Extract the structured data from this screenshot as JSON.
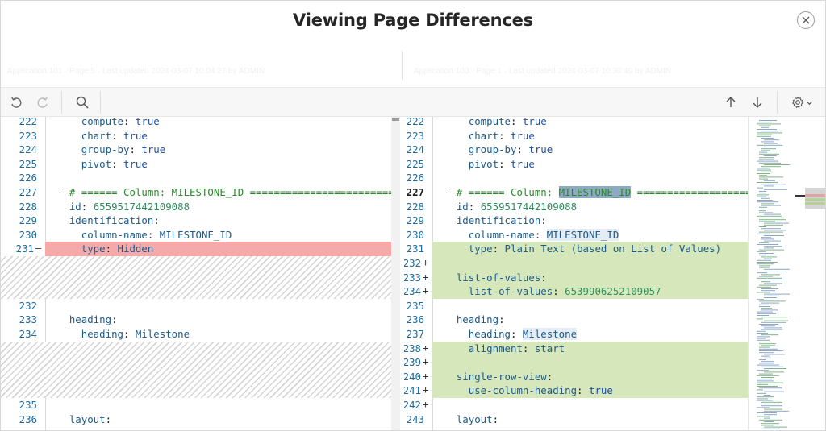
{
  "dialog": {
    "title": "Viewing Page Differences"
  },
  "info": {
    "left": "Application 101 · Page 5 · Last updated 2024-03-07 10:04:27 by ADMIN",
    "right": "Application 100 · Page 1 · Last updated 2024-03-07 10:30:49 by ADMIN"
  },
  "toolbar": {
    "undo_icon": "undo-icon",
    "redo_icon": "redo-icon",
    "search_icon": "search-icon",
    "prev_icon": "arrow-up-icon",
    "next_icon": "arrow-down-icon",
    "settings_icon": "gear-icon"
  },
  "colors": {
    "deleted": "#f5a9a9",
    "added": "#d6e8bb",
    "line_number": "#1e6a9e"
  },
  "left_lines": [
    {
      "num": "222",
      "text": "      compute: true"
    },
    {
      "num": "223",
      "text": "      chart: true"
    },
    {
      "num": "224",
      "text": "      group-by: true"
    },
    {
      "num": "225",
      "text": "      pivot: true"
    },
    {
      "num": "226",
      "text": ""
    },
    {
      "num": "227",
      "text": "  - # ====== Column: MILESTONE_ID ================================="
    },
    {
      "num": "228",
      "text": "    id: 6559517442109088"
    },
    {
      "num": "229",
      "text": "    identification:"
    },
    {
      "num": "230",
      "text": "      column-name: MILESTONE_ID"
    },
    {
      "num": "231",
      "text": "      type: Hidden"
    },
    {
      "num": "232",
      "text": ""
    },
    {
      "num": "233",
      "text": "    heading:"
    },
    {
      "num": "234",
      "text": "      heading: Milestone"
    },
    {
      "num": "235",
      "text": ""
    },
    {
      "num": "236",
      "text": "    layout:"
    }
  ],
  "right_lines": [
    {
      "num": "222",
      "text": "      compute: true"
    },
    {
      "num": "223",
      "text": "      chart: true"
    },
    {
      "num": "224",
      "text": "      group-by: true"
    },
    {
      "num": "225",
      "text": "      pivot: true"
    },
    {
      "num": "226",
      "text": ""
    },
    {
      "num": "227",
      "text": "  - # ====== Column: MILESTONE_ID ========================"
    },
    {
      "num": "228",
      "text": "    id: 6559517442109088"
    },
    {
      "num": "229",
      "text": "    identification:"
    },
    {
      "num": "230",
      "text": "      column-name: MILESTONE_ID"
    },
    {
      "num": "231",
      "text": "      type: Plain Text (based on List of Values)"
    },
    {
      "num": "232",
      "text": ""
    },
    {
      "num": "233",
      "text": "    list-of-values:"
    },
    {
      "num": "234",
      "text": "      list-of-values: 6539906252109057"
    },
    {
      "num": "235",
      "text": ""
    },
    {
      "num": "236",
      "text": "    heading:"
    },
    {
      "num": "237",
      "text": "      heading: Milestone"
    },
    {
      "num": "238",
      "text": "      alignment: start"
    },
    {
      "num": "239",
      "text": ""
    },
    {
      "num": "240",
      "text": "    single-row-view:"
    },
    {
      "num": "241",
      "text": "      use-column-heading: true"
    },
    {
      "num": "242",
      "text": ""
    },
    {
      "num": "243",
      "text": "    layout:"
    }
  ]
}
